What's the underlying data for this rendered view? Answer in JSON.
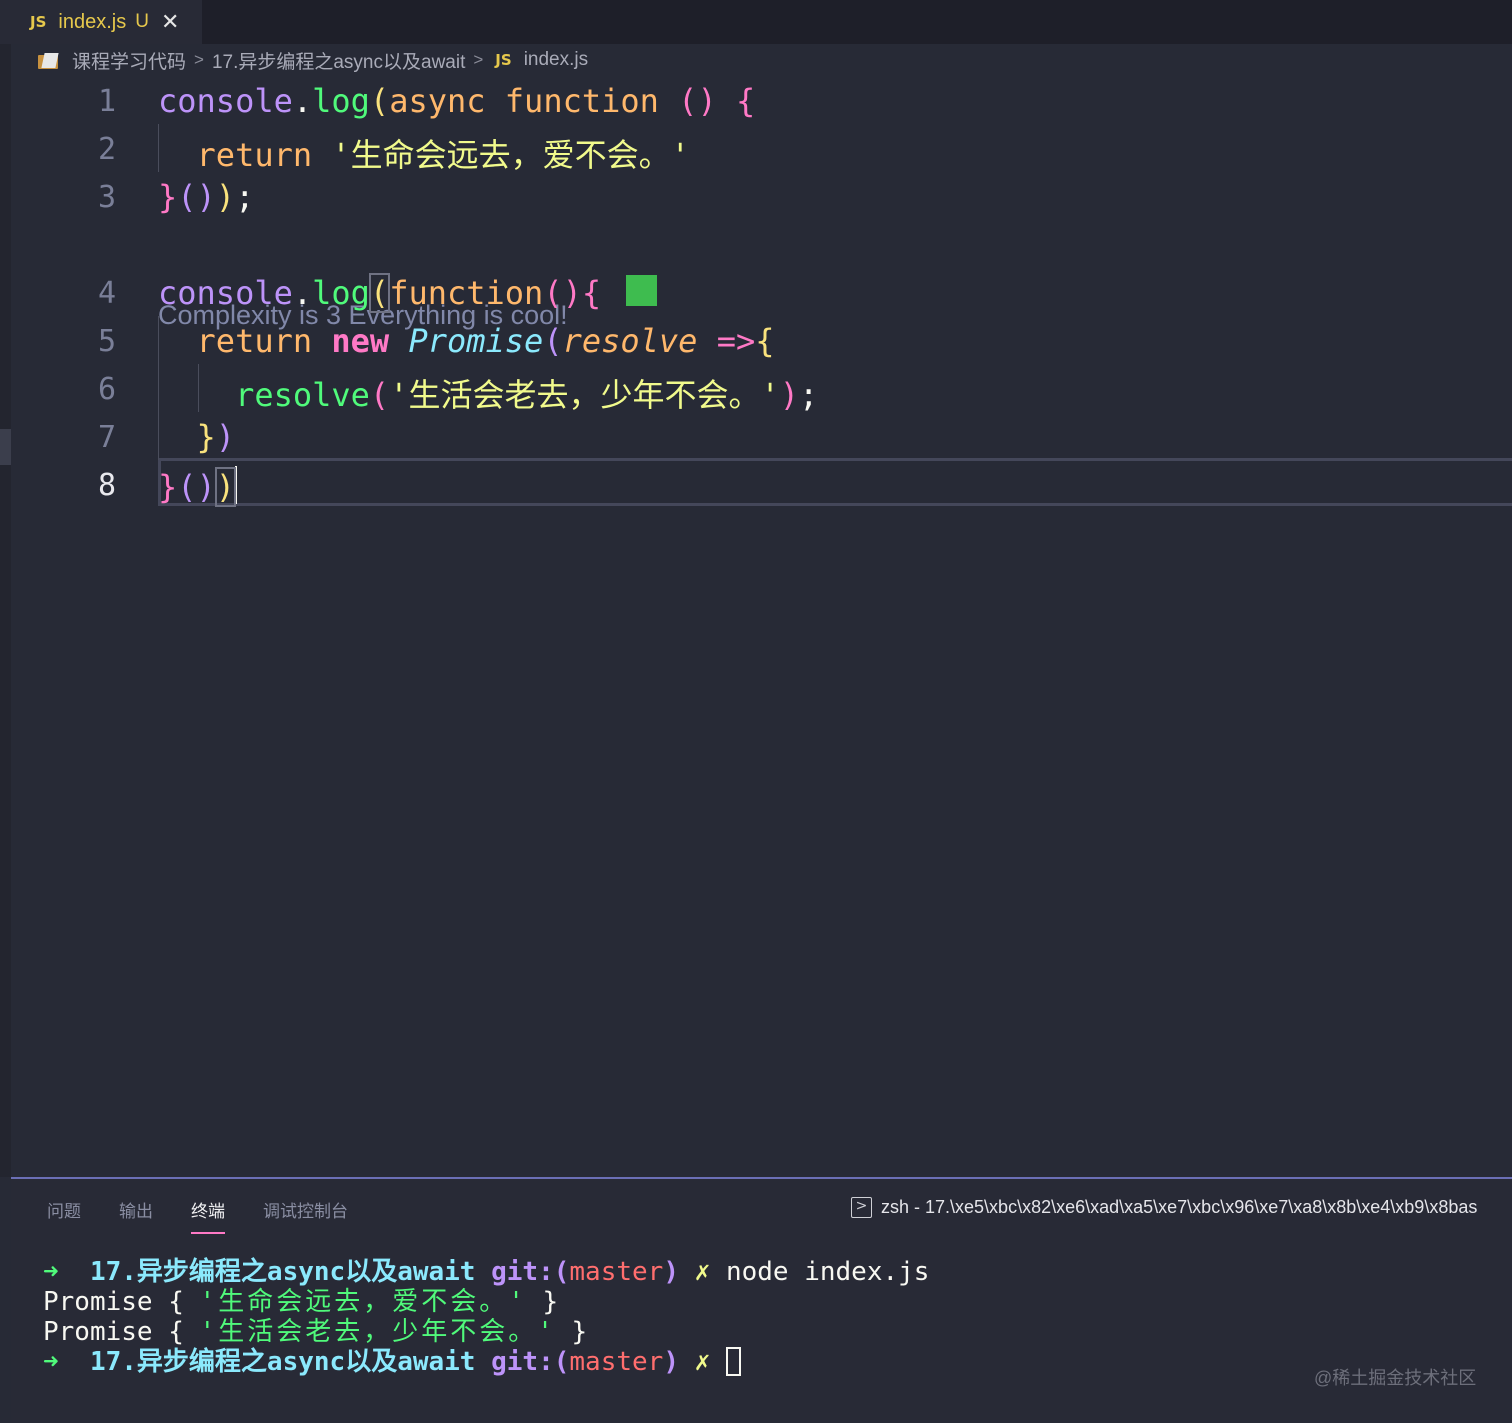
{
  "tab": {
    "badge": "JS",
    "filename": "index.js",
    "status": "U",
    "close": "✕"
  },
  "breadcrumb": {
    "folder": "课程学习代码",
    "sep1": ">",
    "subfolder": "17.异步编程之async以及await",
    "sep2": ">",
    "badge": "JS",
    "file": "index.js"
  },
  "editor": {
    "line_numbers": [
      "1",
      "2",
      "3",
      "4",
      "5",
      "6",
      "7",
      "8"
    ],
    "codelens": "Complexity is 3 Everything is cool!",
    "l1": {
      "obj": "console",
      "dot": ".",
      "fn": "log",
      "p": "(",
      "async": "async",
      "function": "function",
      "paren": "()",
      "brace": "{"
    },
    "l2": {
      "ret": "return",
      "str": "'生命会远去，爱不会。'"
    },
    "l3": {
      "close": "}",
      "parens": "()",
      "rp": ")",
      "semi": ";"
    },
    "l4": {
      "obj": "console",
      "dot": ".",
      "fn": "log",
      "p": "(",
      "function": "function",
      "paren": "()",
      "brace": "{"
    },
    "l5": {
      "ret": "return",
      "new": "new",
      "cls": "Promise",
      "p": "(",
      "param": "resolve",
      "arrow": "=>",
      "brace": "{"
    },
    "l6": {
      "fn": "resolve",
      "p": "(",
      "str": "'生活会老去，少年不会。'",
      "rp": ")",
      "semi": ";"
    },
    "l7": {
      "brace": "}",
      "rp": ")"
    },
    "l8": {
      "brace": "}",
      "parens": "()",
      "rp": ")"
    }
  },
  "panel": {
    "tabs": [
      "问题",
      "输出",
      "终端",
      "调试控制台"
    ],
    "active_tab": "终端",
    "terminal_title": "zsh - 17.\\xe5\\xbc\\x82\\xe6\\xad\\xa5\\xe7\\xbc\\x96\\xe7\\xa8\\x8b\\xe4\\xb9\\x8bas"
  },
  "terminal": {
    "arrow": "➜",
    "dir": "17.异步编程之async以及await",
    "git": "git:(",
    "branch": "master",
    "git_close": ")",
    "dirty": "✗",
    "cmd": "node index.js",
    "out1_pre": "Promise { ",
    "out1_str": "'生命会远去，爱不会。'",
    "out1_post": " }",
    "out2_pre": "Promise { ",
    "out2_str": "'生活会老去，少年不会。'",
    "out2_post": " }"
  },
  "watermark": "@稀土掘金技术社区",
  "colors": {
    "background": "#272a36",
    "purple": "#bd93f9",
    "pink": "#ff79c6",
    "orange": "#ffb86c",
    "green": "#50fa7b",
    "yellow": "#f1fa8c",
    "cyan": "#8be9fd"
  }
}
